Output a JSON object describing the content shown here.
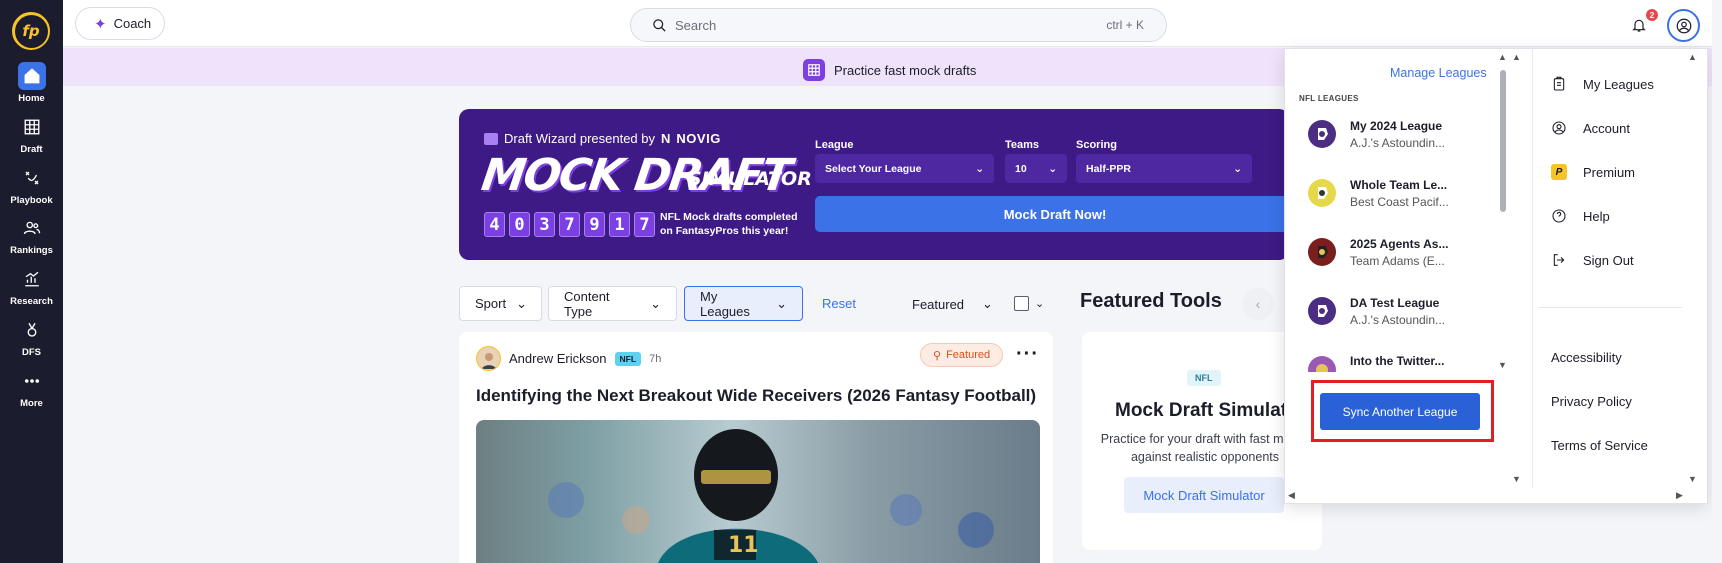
{
  "nav": {
    "logo": "fp",
    "items": [
      {
        "label": "Home",
        "icon": "home-icon"
      },
      {
        "label": "Draft",
        "icon": "grid-icon"
      },
      {
        "label": "Playbook",
        "icon": "playbook-icon"
      },
      {
        "label": "Rankings",
        "icon": "users-icon"
      },
      {
        "label": "Research",
        "icon": "chart-icon"
      },
      {
        "label": "DFS",
        "icon": "medal-icon"
      },
      {
        "label": "More",
        "icon": "more-icon"
      }
    ]
  },
  "topbar": {
    "coach_label": "Coach",
    "search_placeholder": "Search",
    "search_shortcut": "ctrl + K",
    "notification_count": "2"
  },
  "promo": {
    "text": "Practice fast mock drafts"
  },
  "banner": {
    "presented_by": "Draft Wizard presented by",
    "sponsor": "NOVIG",
    "title": "MOCK DRAFT",
    "subtitle": "SIMULATOR",
    "counter_digits": [
      "4",
      "0",
      "3",
      "7",
      "9",
      "1",
      "7"
    ],
    "counter_caption": "NFL Mock drafts completed on FantasyPros this year!",
    "league_label": "League",
    "league_value": "Select Your League",
    "teams_label": "Teams",
    "teams_value": "10",
    "scoring_label": "Scoring",
    "scoring_value": "Half-PPR",
    "cta": "Mock Draft Now!"
  },
  "filters": {
    "sport": "Sport",
    "content_type": "Content Type",
    "my_leagues": "My Leagues",
    "reset": "Reset",
    "sort": "Featured"
  },
  "featured_tools": {
    "heading": "Featured Tools",
    "badge": "NFL",
    "title": "Mock Draft Simulator",
    "description": "Practice for your draft with fast mocks against realistic opponents",
    "button": "Mock Draft Simulator"
  },
  "article": {
    "author": "Andrew Erickson",
    "sport_badge": "NFL",
    "age": "7h",
    "featured_badge": "Featured",
    "title": "Identifying the Next Breakout Wide Receivers (2026 Fantasy Football)"
  },
  "dropdown": {
    "manage_leagues": "Manage Leagues",
    "section_label": "NFL LEAGUES",
    "leagues": [
      {
        "name": "My 2024 League",
        "team": "A.J.'s Astoundin...",
        "helmet_color": "#4b2e83"
      },
      {
        "name": "Whole Team Le...",
        "team": "Best Coast Pacif...",
        "helmet_color": "#e6d84a"
      },
      {
        "name": "2025 Agents As...",
        "team": "Team Adams (E...",
        "helmet_color": "#7a1e1e"
      },
      {
        "name": "DA Test League",
        "team": "A.J.'s Astoundin...",
        "helmet_color": "#4b2e83"
      },
      {
        "name": "Into the Twitter...",
        "team": "",
        "helmet_color": "#9b59b6"
      }
    ],
    "sync_button": "Sync Another League",
    "menu": [
      {
        "label": "My Leagues",
        "icon": "clipboard-icon"
      },
      {
        "label": "Account",
        "icon": "account-icon"
      },
      {
        "label": "Premium",
        "icon": "premium-icon"
      },
      {
        "label": "Help",
        "icon": "help-icon"
      },
      {
        "label": "Sign Out",
        "icon": "signout-icon"
      }
    ],
    "footer_links": [
      "Accessibility",
      "Privacy Policy",
      "Terms of Service"
    ]
  }
}
